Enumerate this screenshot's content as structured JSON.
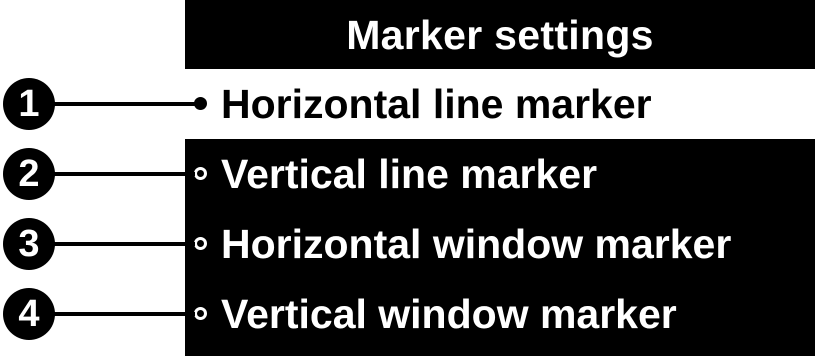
{
  "menu": {
    "title": "Marker settings",
    "items": [
      {
        "label": "Horizontal line marker",
        "selected": true
      },
      {
        "label": "Vertical line marker",
        "selected": false
      },
      {
        "label": "Horizontal window marker",
        "selected": false
      },
      {
        "label": "Vertical window marker",
        "selected": false
      }
    ]
  },
  "callouts": [
    {
      "number": "1"
    },
    {
      "number": "2"
    },
    {
      "number": "3"
    },
    {
      "number": "4"
    }
  ],
  "colors": {
    "panel_background": "#000000",
    "selected_background": "#ffffff",
    "text_on_panel": "#ffffff",
    "text_on_selected": "#000000"
  }
}
